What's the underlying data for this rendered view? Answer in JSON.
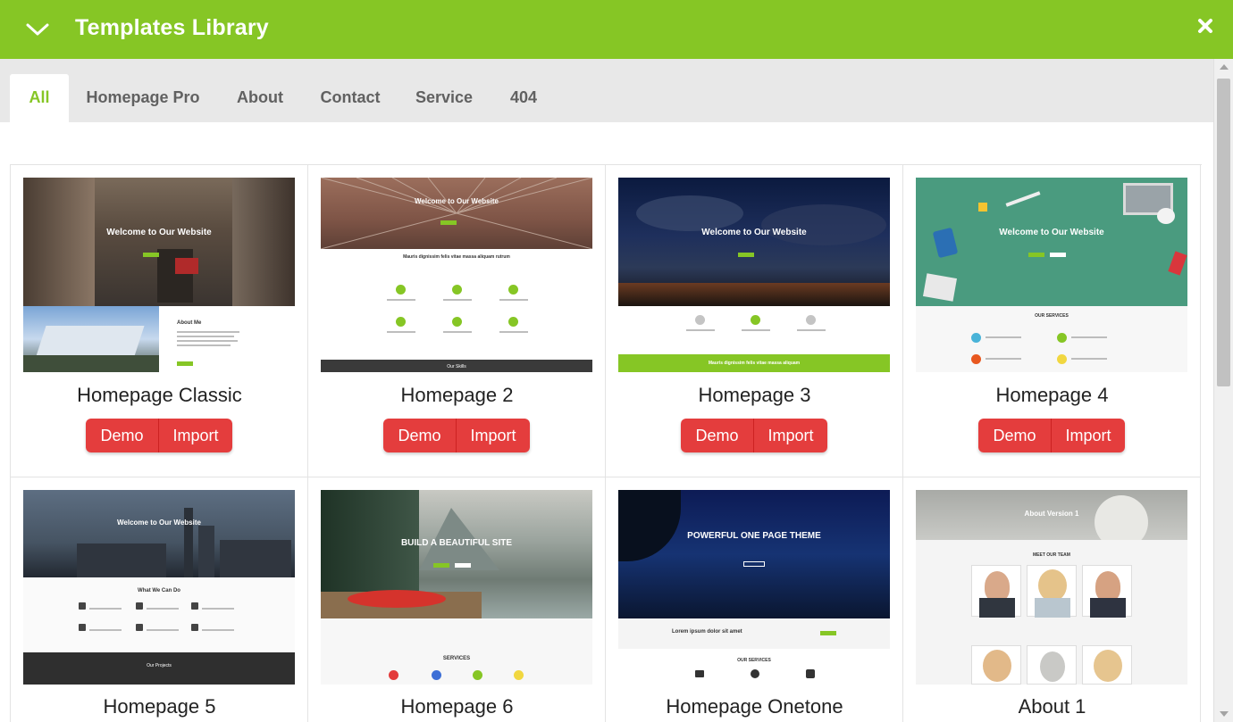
{
  "header": {
    "title": "Templates Library",
    "collapse_icon": "chevron-down-icon",
    "close_icon": "close-icon",
    "bg_color": "#86c625"
  },
  "tabs": [
    {
      "label": "All",
      "active": true
    },
    {
      "label": "Homepage Pro",
      "active": false
    },
    {
      "label": "About",
      "active": false
    },
    {
      "label": "Contact",
      "active": false
    },
    {
      "label": "Service",
      "active": false
    },
    {
      "label": "404",
      "active": false
    }
  ],
  "cards": [
    {
      "name": "Homepage Classic",
      "demo_label": "Demo",
      "import_label": "Import",
      "thumb": {
        "hero_text": "Welcome to Our Website",
        "lower_text": "About Me"
      }
    },
    {
      "name": "Homepage 2",
      "demo_label": "Demo",
      "import_label": "Import",
      "thumb": {
        "hero_text": "Welcome to Our Website",
        "lower_text": "Mauris dignissim felis vitae massa aliquam rutrum",
        "footer_text": "Our Skills"
      }
    },
    {
      "name": "Homepage 3",
      "demo_label": "Demo",
      "import_label": "Import",
      "thumb": {
        "hero_text": "Welcome to Our Website",
        "lower_text": "Mauris dignissim felis vitae massa aliquam"
      }
    },
    {
      "name": "Homepage 4",
      "demo_label": "Demo",
      "import_label": "Import",
      "thumb": {
        "hero_text": "Welcome to Our Website",
        "lower_text": "OUR SERVICES"
      }
    },
    {
      "name": "Homepage 5",
      "thumb": {
        "hero_text": "Welcome to Our Website",
        "lower_text": "What We Can Do",
        "footer_text": "Our Projects"
      }
    },
    {
      "name": "Homepage 6",
      "thumb": {
        "hero_text": "BUILD A BEAUTIFUL SITE",
        "lower_text": "SERVICES"
      }
    },
    {
      "name": "Homepage Onetone",
      "thumb": {
        "hero_text": "POWERFUL ONE PAGE THEME",
        "lower_text": "Lorem ipsum dolor sit amet",
        "footer_text": "OUR SERVICES"
      }
    },
    {
      "name": "About 1",
      "thumb": {
        "hero_text": "About Version 1",
        "lower_text": "MEET OUR TEAM"
      }
    }
  ],
  "colors": {
    "accent": "#86c625",
    "button": "#e43d3d",
    "tab_text": "#616161"
  }
}
